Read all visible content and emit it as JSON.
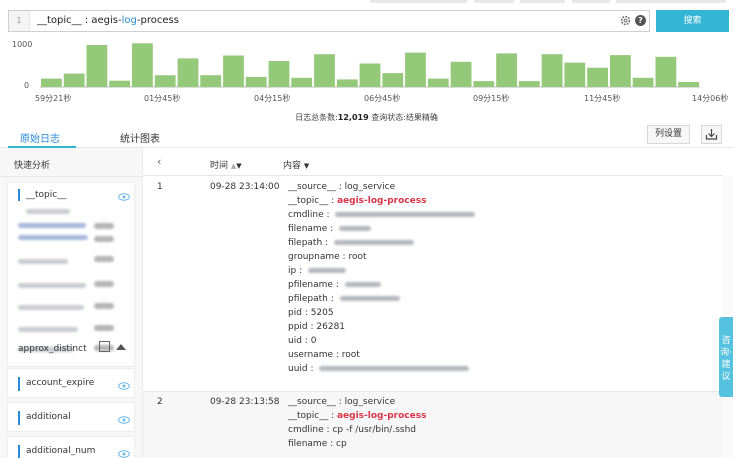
{
  "query": {
    "line_number": "1",
    "text_before": "__topic__ : aegis-",
    "text_highlight": "log",
    "text_after": "-process",
    "search_label": "搜索"
  },
  "histogram": {
    "y_ticks": [
      "1000",
      "0"
    ],
    "x_ticks": [
      "59分21秒",
      "01分45秒",
      "04分15秒",
      "06分45秒",
      "09分15秒",
      "11分45秒",
      "14分06秒"
    ],
    "bar_color": "#95c97a",
    "relative_heights": [
      0.2,
      0.32,
      1.0,
      0.15,
      1.04,
      0.28,
      0.68,
      0.28,
      0.75,
      0.24,
      0.62,
      0.22,
      0.78,
      0.18,
      0.56,
      0.33,
      0.82,
      0.2,
      0.6,
      0.14,
      0.8,
      0.14,
      0.78,
      0.58,
      0.46,
      0.76,
      0.22,
      0.72,
      0.12
    ]
  },
  "summary": {
    "total_label": "日志总条数:",
    "total_value": "12,019",
    "status_label": "查询状态:",
    "status_value": "结果精确"
  },
  "tabs": {
    "raw_logs": "原始日志",
    "stats_chart": "统计图表",
    "column_settings": "列设置"
  },
  "sidebar": {
    "title": "快速分析",
    "topic_field": "__topic__",
    "approx_label": "approx_distinct",
    "fields": [
      "account_expire",
      "additional",
      "additional_num"
    ]
  },
  "table": {
    "col_time": "时间",
    "col_content": "内容",
    "rows": [
      {
        "num": "1",
        "time": "09-28 23:14:00",
        "source_key": "__source__",
        "source_val": "log_service",
        "topic_key": "__topic__",
        "topic_val": "aegis-log-process",
        "cmdline_key": "cmdline",
        "filename_key": "filename",
        "filepath_key": "filepath",
        "groupname_key": "groupname",
        "groupname_val": "root",
        "ip_key": "ip",
        "pfilename_key": "pfilename",
        "pfilepath_key": "pfilepath",
        "pid_key": "pid",
        "pid_val": "5205",
        "ppid_key": "ppid",
        "ppid_val": "26281",
        "uid_key": "uid",
        "uid_val": "0",
        "username_key": "username",
        "username_val": "root",
        "uuid_key": "uuid"
      },
      {
        "num": "2",
        "time": "09-28 23:13:58",
        "source_key": "__source__",
        "source_val": "log_service",
        "topic_key": "__topic__",
        "topic_val": "aegis-log-process",
        "cmdline_key": "cmdline",
        "cmdline_val": "cp -f /usr/bin/.sshd",
        "filename_key": "filename",
        "filename_val": "cp"
      }
    ]
  },
  "feedback_label": "咨询·建议"
}
